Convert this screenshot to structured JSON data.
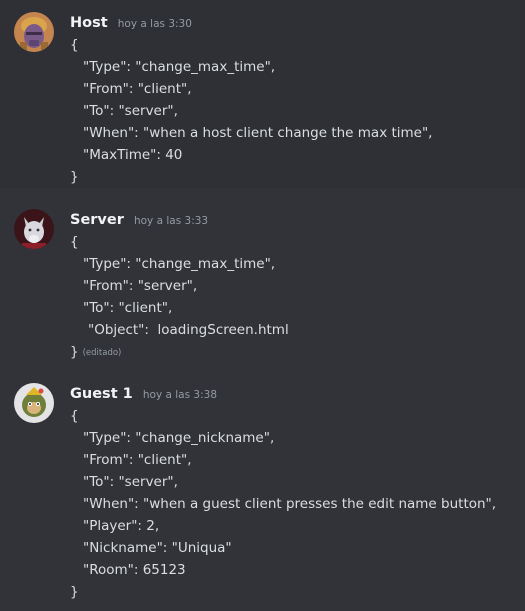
{
  "messages": [
    {
      "username": "Host",
      "timestamp": "hoy a las 3:30",
      "avatar_icon": "thanos-avatar-icon",
      "lines": {
        "open": "{",
        "l1": "\"Type\": \"change_max_time\",",
        "l2": "\"From\": \"client\",",
        "l3": "\"To\": \"server\",",
        "l4": "\"When\": \"when a host client change the max time\",",
        "l5": "\"MaxTime\": 40",
        "close": "}"
      }
    },
    {
      "username": "Server",
      "timestamp": "hoy a las 3:33",
      "avatar_icon": "wolf-avatar-icon",
      "edited_label": "(editado)",
      "lines": {
        "open": "{",
        "l1": "\"Type\": \"change_max_time\",",
        "l2": "\"From\": \"server\",",
        "l3": "\"To\": \"client\",",
        "l4": "\"Object\":  loadingScreen.html",
        "close": "}"
      }
    },
    {
      "username": "Guest 1",
      "timestamp": "hoy a las 3:38",
      "avatar_icon": "character-avatar-icon",
      "lines": {
        "open": "{",
        "l1": "\"Type\": \"change_nickname\",",
        "l2": "\"From\": \"client\",",
        "l3": "\"To\": \"server\",",
        "l4": "\"When\": \"when a guest client presses the edit name button\",",
        "l5": "\"Player\": 2,",
        "l6": "\"Nickname\": \"Uniqua\"",
        "l7": "\"Room\": 65123",
        "close": "}"
      }
    }
  ],
  "colors": {
    "background": "#313338",
    "hover_background": "#2e3035",
    "username": "#f2f3f5",
    "timestamp": "#949ba4",
    "text": "#dbdee1"
  }
}
